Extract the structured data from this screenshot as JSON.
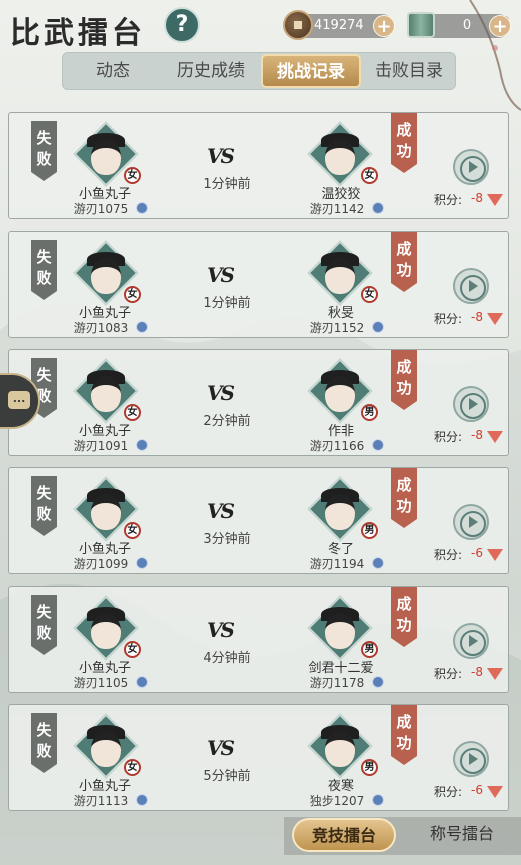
{
  "header": {
    "title": "比武擂台",
    "help_label": "?",
    "coins": "419274",
    "tokens": "0",
    "plus": "+"
  },
  "tabs": [
    {
      "label": "动态"
    },
    {
      "label": "历史成绩"
    },
    {
      "label": "挑战记录",
      "active": true
    },
    {
      "label": "击败目录"
    }
  ],
  "vs_label": "VS",
  "score_label": "积分:",
  "records": [
    {
      "left_result": "失败",
      "right_result": "成功",
      "left_name": "小鱼丸子",
      "left_rank": "游刃1075",
      "left_gender": "女",
      "time": "1分钟前",
      "right_name": "温狡狡",
      "right_rank": "游刃1142",
      "right_gender": "女",
      "score": "-8"
    },
    {
      "left_result": "失败",
      "right_result": "成功",
      "left_name": "小鱼丸子",
      "left_rank": "游刃1083",
      "left_gender": "女",
      "time": "1分钟前",
      "right_name": "秋旻",
      "right_rank": "游刃1152",
      "right_gender": "女",
      "score": "-8"
    },
    {
      "left_result": "失败",
      "right_result": "成功",
      "left_name": "小鱼丸子",
      "left_rank": "游刃1091",
      "left_gender": "女",
      "time": "2分钟前",
      "right_name": "作非",
      "right_rank": "游刃1166",
      "right_gender": "男",
      "score": "-8"
    },
    {
      "left_result": "失败",
      "right_result": "成功",
      "left_name": "小鱼丸子",
      "left_rank": "游刃1099",
      "left_gender": "女",
      "time": "3分钟前",
      "right_name": "冬了",
      "right_rank": "游刃1194",
      "right_gender": "男",
      "score": "-6"
    },
    {
      "left_result": "失败",
      "right_result": "成功",
      "left_name": "小鱼丸子",
      "left_rank": "游刃1105",
      "left_gender": "女",
      "time": "4分钟前",
      "right_name": "剑君十二爱",
      "right_rank": "游刃1178",
      "right_gender": "男",
      "score": "-8"
    },
    {
      "left_result": "失败",
      "right_result": "成功",
      "left_name": "小鱼丸子",
      "left_rank": "游刃1113",
      "left_gender": "女",
      "time": "5分钟前",
      "right_name": "夜寒",
      "right_rank": "独步1207",
      "right_gender": "男",
      "score": "-6"
    }
  ],
  "bottom_tabs": [
    {
      "label": "竞技擂台",
      "active": true
    },
    {
      "label": "称号擂台"
    }
  ],
  "chat_label": "..."
}
